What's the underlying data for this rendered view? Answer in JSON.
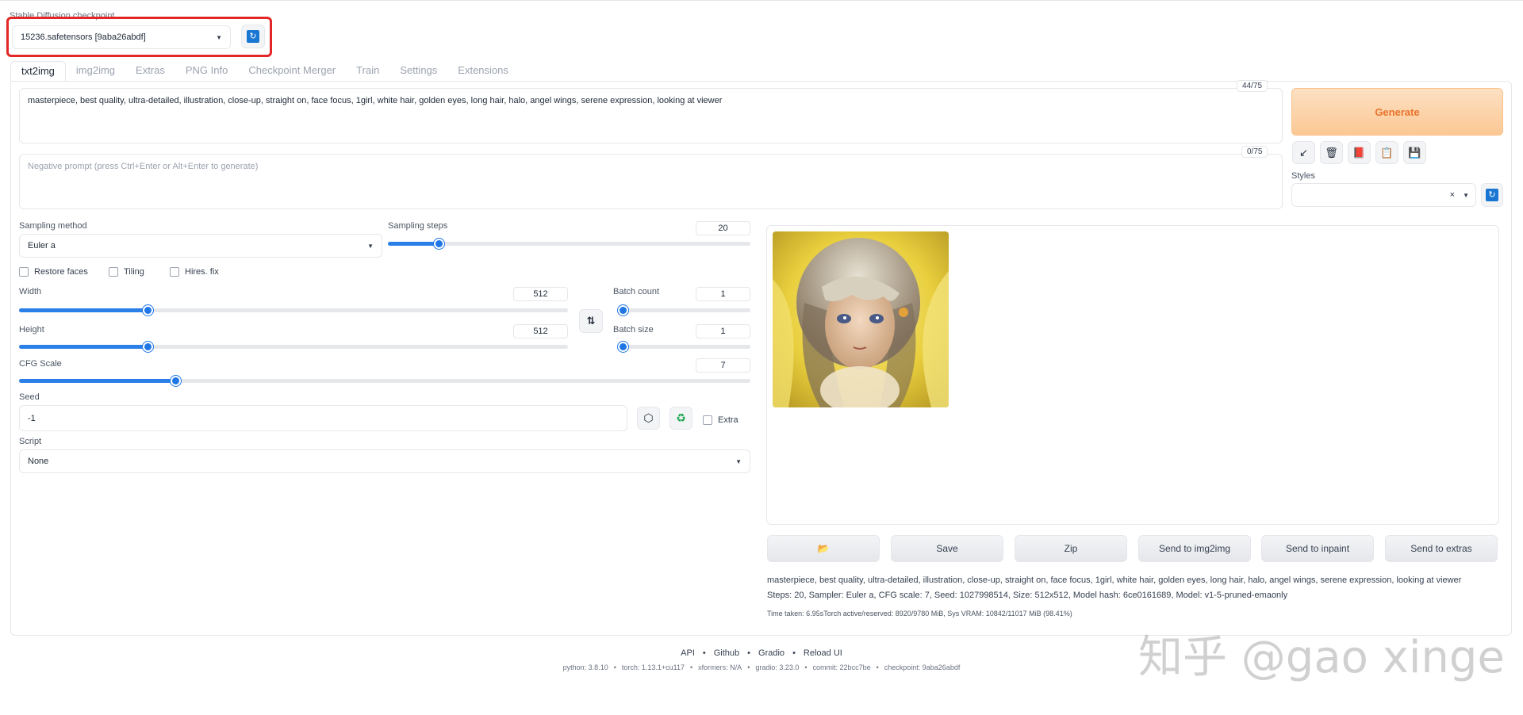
{
  "checkpoint": {
    "label": "Stable Diffusion checkpoint",
    "value": "15236.safetensors [9aba26abdf]"
  },
  "tabs": [
    "txt2img",
    "img2img",
    "Extras",
    "PNG Info",
    "Checkpoint Merger",
    "Train",
    "Settings",
    "Extensions"
  ],
  "prompt": {
    "positive": "masterpiece, best quality, ultra-detailed, illustration, close-up, straight on, face focus, 1girl, white hair, golden eyes, long hair, halo, angel wings, serene expression, looking at viewer",
    "positive_counter": "44/75",
    "negative_placeholder": "Negative prompt (press Ctrl+Enter or Alt+Enter to generate)",
    "negative_counter": "0/75"
  },
  "generate_label": "Generate",
  "tools": {
    "arrow": "↙",
    "trash": "🗑",
    "card": "📕",
    "clipboard": "📋",
    "save": "💾"
  },
  "styles": {
    "label": "Styles",
    "clear": "×",
    "value": ""
  },
  "sampling": {
    "method_label": "Sampling method",
    "method_value": "Euler a",
    "steps_label": "Sampling steps",
    "steps_value": "20",
    "steps_fraction": 0.13
  },
  "checkboxes": {
    "restore_faces": "Restore faces",
    "tiling": "Tiling",
    "hires_fix": "Hires. fix"
  },
  "width": {
    "label": "Width",
    "value": "512",
    "fraction": 0.23
  },
  "height": {
    "label": "Height",
    "value": "512",
    "fraction": 0.23
  },
  "batch_count": {
    "label": "Batch count",
    "value": "1",
    "fraction": 0.0
  },
  "batch_size": {
    "label": "Batch size",
    "value": "1",
    "fraction": 0.0
  },
  "cfg": {
    "label": "CFG Scale",
    "value": "7",
    "fraction": 0.21
  },
  "seed": {
    "label": "Seed",
    "value": "-1",
    "extra_label": "Extra"
  },
  "script": {
    "label": "Script",
    "value": "None"
  },
  "output_buttons": {
    "folder": "📂",
    "save": "Save",
    "zip": "Zip",
    "img2img": "Send to img2img",
    "inpaint": "Send to inpaint",
    "extras": "Send to extras"
  },
  "generation_info": {
    "prompt": "masterpiece, best quality, ultra-detailed, illustration, close-up, straight on, face focus, 1girl, white hair, golden eyes, long hair, halo, angel wings, serene expression, looking at viewer",
    "params": "Steps: 20, Sampler: Euler a, CFG scale: 7, Seed: 1027998514, Size: 512x512, Model hash: 6ce0161689, Model: v1-5-pruned-emaonly",
    "time": "Time taken: 6.95sTorch active/reserved: 8920/9780 MiB, Sys VRAM: 10842/11017 MiB (98.41%)"
  },
  "footer": {
    "links": [
      "API",
      "Github",
      "Gradio",
      "Reload UI"
    ],
    "versions": [
      "python: 3.8.10",
      "torch: 1.13.1+cu117",
      "xformers: N/A",
      "gradio: 3.23.0",
      "commit: 22bcc7be",
      "checkpoint: 9aba26abdf"
    ]
  },
  "watermark": "知乎 @gao xinge",
  "colors": {
    "accent": "#2b7fe8",
    "generate_text": "#e8742d",
    "highlight": "#e32626"
  }
}
